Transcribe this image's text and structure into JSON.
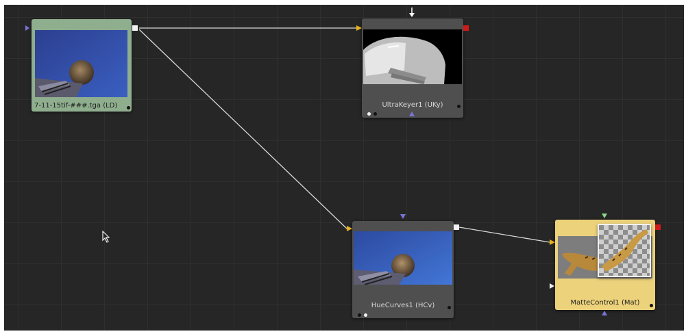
{
  "flow": {
    "nodes": {
      "loader": {
        "label": "7-11-15tif-###.tga  (LD)"
      },
      "ultrakeyer": {
        "label": "UltraKeyer1  (UKy)"
      },
      "huecurves": {
        "label": "HueCurves1  (HCv)"
      },
      "mattecontrol": {
        "label": "MatteControl1  (Mat)"
      }
    },
    "colors": {
      "canvas": "#262626",
      "loader_tile": "#8fae8e",
      "mattecontrol_tile": "#ecd27b",
      "tile": "#4f4f4f",
      "input_port": "#e8b11a",
      "mask_port": "#7a73d8",
      "output_port_active": "#d11a1a",
      "wire": "#d9d9d9"
    }
  }
}
